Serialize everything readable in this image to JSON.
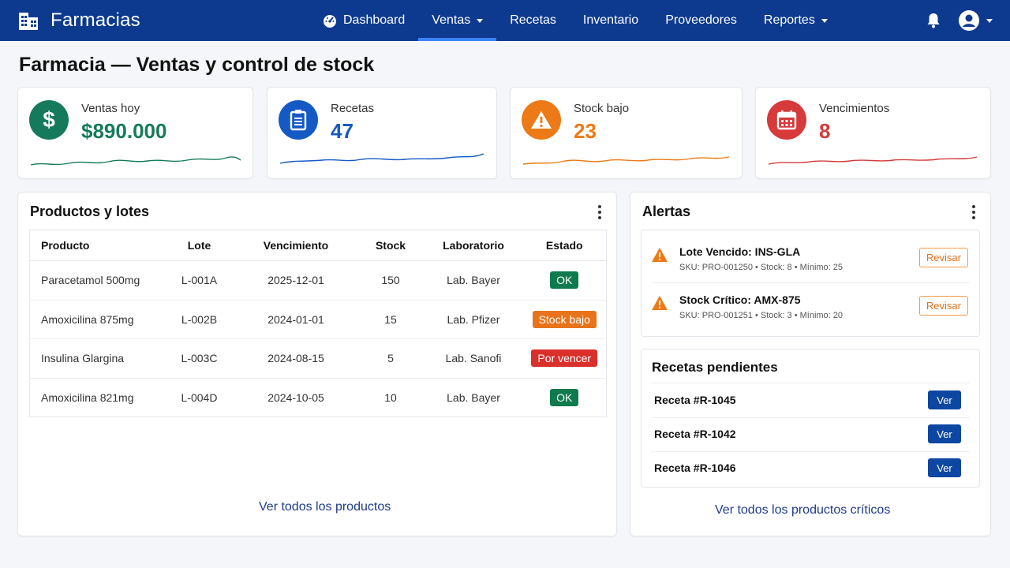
{
  "app": {
    "name": "Farmacias"
  },
  "nav": {
    "items": [
      {
        "label": "Dashboard",
        "icon": "speedometer-icon"
      },
      {
        "label": "Ventas",
        "dropdown": true,
        "active": true
      },
      {
        "label": "Recetas"
      },
      {
        "label": "Inventario"
      },
      {
        "label": "Proveedores"
      },
      {
        "label": "Reportes",
        "dropdown": true
      }
    ]
  },
  "page": {
    "title": "Farmacia — Ventas y control de stock"
  },
  "kpis": [
    {
      "label": "Ventas hoy",
      "value": "$890.000",
      "color": "#157a5c",
      "icon": "dollar-icon"
    },
    {
      "label": "Recetas",
      "value": "47",
      "color": "#1559c4",
      "icon": "clipboard-icon"
    },
    {
      "label": "Stock bajo",
      "value": "23",
      "color": "#ec7a16",
      "icon": "warning-icon"
    },
    {
      "label": "Vencimientos",
      "value": "8",
      "color": "#d63a3a",
      "icon": "calendar-icon"
    }
  ],
  "products": {
    "title": "Productos y lotes",
    "columns": [
      "Producto",
      "Lote",
      "Vencimiento",
      "Stock",
      "Laboratorio",
      "Estado"
    ],
    "rows": [
      {
        "producto": "Paracetamol 500mg",
        "lote": "L-001A",
        "vencimiento": "2025-12-01",
        "stock": "150",
        "laboratorio": "Lab. Bayer",
        "estado": "OK",
        "estado_color": "#0f7a4e"
      },
      {
        "producto": "Amoxicilina 875mg",
        "lote": "L-002B",
        "vencimiento": "2024-01-01",
        "stock": "15",
        "laboratorio": "Lab. Pfizer",
        "estado": "Stock bajo",
        "estado_color": "#e8731a"
      },
      {
        "producto": "Insulina Glargina",
        "lote": "L-003C",
        "vencimiento": "2024-08-15",
        "stock": "5",
        "laboratorio": "Lab. Sanofi",
        "estado": "Por vencer",
        "estado_color": "#d9302c"
      },
      {
        "producto": "Amoxicilina 821mg",
        "lote": "L-004D",
        "vencimiento": "2024-10-05",
        "stock": "10",
        "laboratorio": "Lab. Bayer",
        "estado": "OK",
        "estado_color": "#0f7a4e"
      }
    ],
    "footer_link": "Ver todos los productos"
  },
  "alerts": {
    "title": "Alertas",
    "items": [
      {
        "title": "Lote Vencido: INS-GLA",
        "meta": "SKU: PRO-001250  •  Stock: 8  •  Mínimo: 25",
        "action": "Revisar"
      },
      {
        "title": "Stock Crítico: AMX-875",
        "meta": "SKU: PRO-001251  •  Stock: 3  •  Mínimo: 20",
        "action": "Revisar"
      }
    ]
  },
  "prescriptions": {
    "title": "Recetas pendientes",
    "items": [
      {
        "label": "Receta #R-1045",
        "action": "Ver"
      },
      {
        "label": "Receta #R-1042",
        "action": "Ver"
      },
      {
        "label": "Receta #R-1046",
        "action": "Ver"
      }
    ],
    "footer_link": "Ver todos los productos críticos"
  }
}
